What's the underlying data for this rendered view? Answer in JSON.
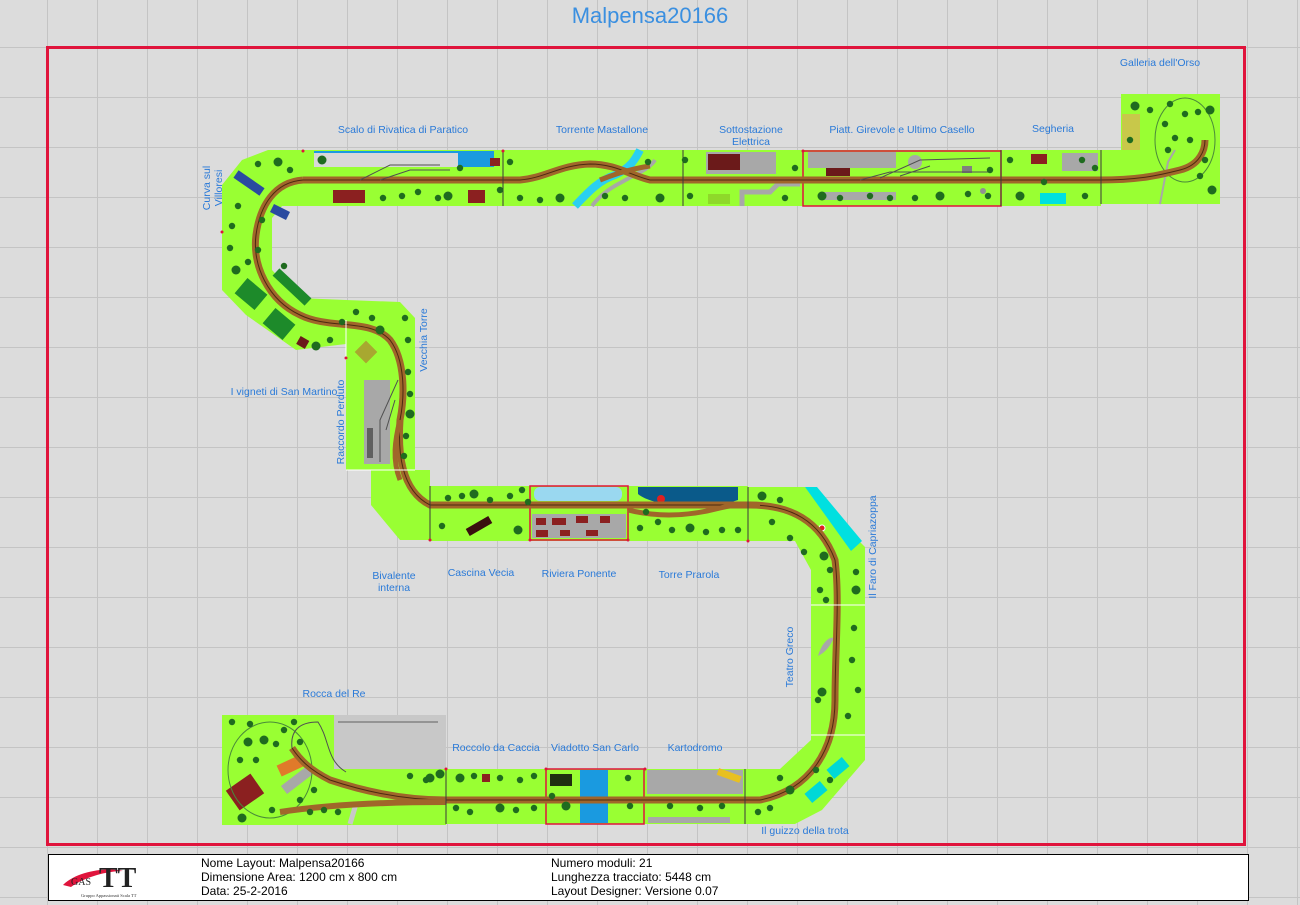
{
  "title": "Malpensa20166",
  "modules": [
    {
      "label": "Scalo di Rivatica di Paratico"
    },
    {
      "label": "Torrente Mastallone"
    },
    {
      "label": "Sottostazione Elettrica"
    },
    {
      "label": "Piatt. Girevole e Ultimo Casello"
    },
    {
      "label": "Segheria"
    },
    {
      "label": "Galleria dell'Orso"
    },
    {
      "label": "Curva sul Villoresi"
    },
    {
      "label": "I vigneti di San Martino"
    },
    {
      "label": "Vecchia Torre"
    },
    {
      "label": "Raccordo Perduto"
    },
    {
      "label": "Bivalente interna"
    },
    {
      "label": "Cascina Vecia"
    },
    {
      "label": "Riviera Ponente"
    },
    {
      "label": "Torre Prarola"
    },
    {
      "label": "Il Faro di Capriazoppa"
    },
    {
      "label": "Teatro Greco"
    },
    {
      "label": "Rocca del Re"
    },
    {
      "label": "Roccolo da Caccia"
    },
    {
      "label": "Viadotto San Carlo"
    },
    {
      "label": "Kartodromo"
    },
    {
      "label": "Il guizzo della trota"
    }
  ],
  "info": {
    "nome_layout": "Nome Layout: Malpensa20166",
    "dimensione_area": "Dimensione Area: 1200 cm x 800 cm",
    "data": "Data: 25-2-2016",
    "numero_moduli": "Numero moduli: 21",
    "lunghezza_tracciato": "Lunghezza tracciato: 5448 cm",
    "layout_designer": "Layout Designer: Versione 0.07"
  },
  "logo": {
    "gas": "GAS",
    "tt": "TT",
    "subtitle": "Gruppo Appassionati Scala TT"
  },
  "colors": {
    "border": "#e0143c",
    "module_green": "#99ff33",
    "track": "#a0662a",
    "label": "#2a7ad8"
  }
}
